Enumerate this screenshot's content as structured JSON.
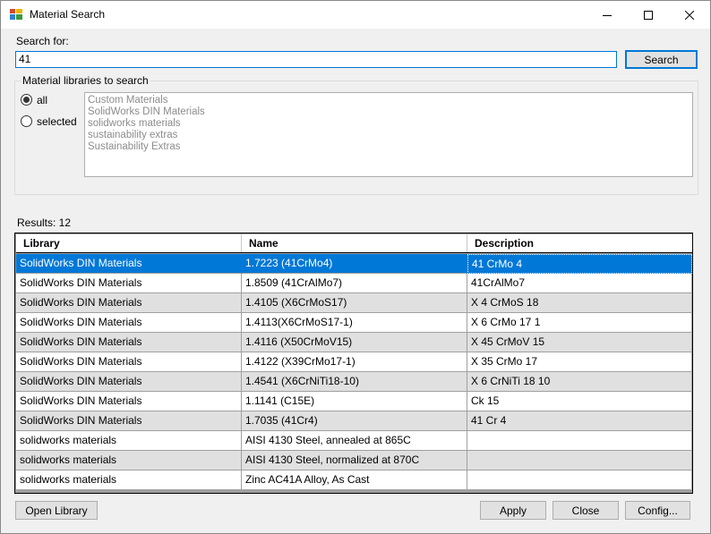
{
  "window": {
    "title": "Material Search"
  },
  "search": {
    "label": "Search for:",
    "value": "41",
    "button_label": "Search"
  },
  "libraries": {
    "group_label": "Material libraries to search",
    "radio_all_label": "all",
    "radio_selected_label": "selected",
    "selected_option": "all",
    "items": [
      "Custom Materials",
      "SolidWorks DIN Materials",
      "solidworks materials",
      "sustainability extras",
      "Sustainability Extras"
    ]
  },
  "results": {
    "label": "Results: 12",
    "columns": [
      "Library",
      "Name",
      "Description"
    ],
    "rows": [
      [
        "SolidWorks DIN Materials",
        "1.7223 (41CrMo4)",
        "41 CrMo 4"
      ],
      [
        "SolidWorks DIN Materials",
        "1.8509 (41CrAlMo7)",
        "41CrAlMo7"
      ],
      [
        "SolidWorks DIN Materials",
        "1.4105 (X6CrMoS17)",
        "X 4 CrMoS 18"
      ],
      [
        "SolidWorks DIN Materials",
        "1.4113(X6CrMoS17-1)",
        "X 6 CrMo 17 1"
      ],
      [
        "SolidWorks DIN Materials",
        "1.4116 (X50CrMoV15)",
        "X 45 CrMoV 15"
      ],
      [
        "SolidWorks DIN Materials",
        "1.4122 (X39CrMo17-1)",
        "X 35 CrMo 17"
      ],
      [
        "SolidWorks DIN Materials",
        "1.4541 (X6CrNiTi18-10)",
        "X 6 CrNiTi 18 10"
      ],
      [
        "SolidWorks DIN Materials",
        "1.1141 (C15E)",
        "Ck 15"
      ],
      [
        "SolidWorks DIN Materials",
        "1.7035 (41Cr4)",
        "41 Cr 4"
      ],
      [
        "solidworks materials",
        "AISI 4130 Steel, annealed at 865C",
        ""
      ],
      [
        "solidworks materials",
        "AISI 4130 Steel, normalized at 870C",
        ""
      ],
      [
        "solidworks materials",
        "Zinc AC41A Alloy, As Cast",
        ""
      ]
    ],
    "selected_index": 0
  },
  "footer": {
    "open_library": "Open Library",
    "apply": "Apply",
    "close": "Close",
    "config": "Config..."
  },
  "colors": {
    "accent": "#0078d7",
    "row_alt": "#e0e0e0"
  }
}
